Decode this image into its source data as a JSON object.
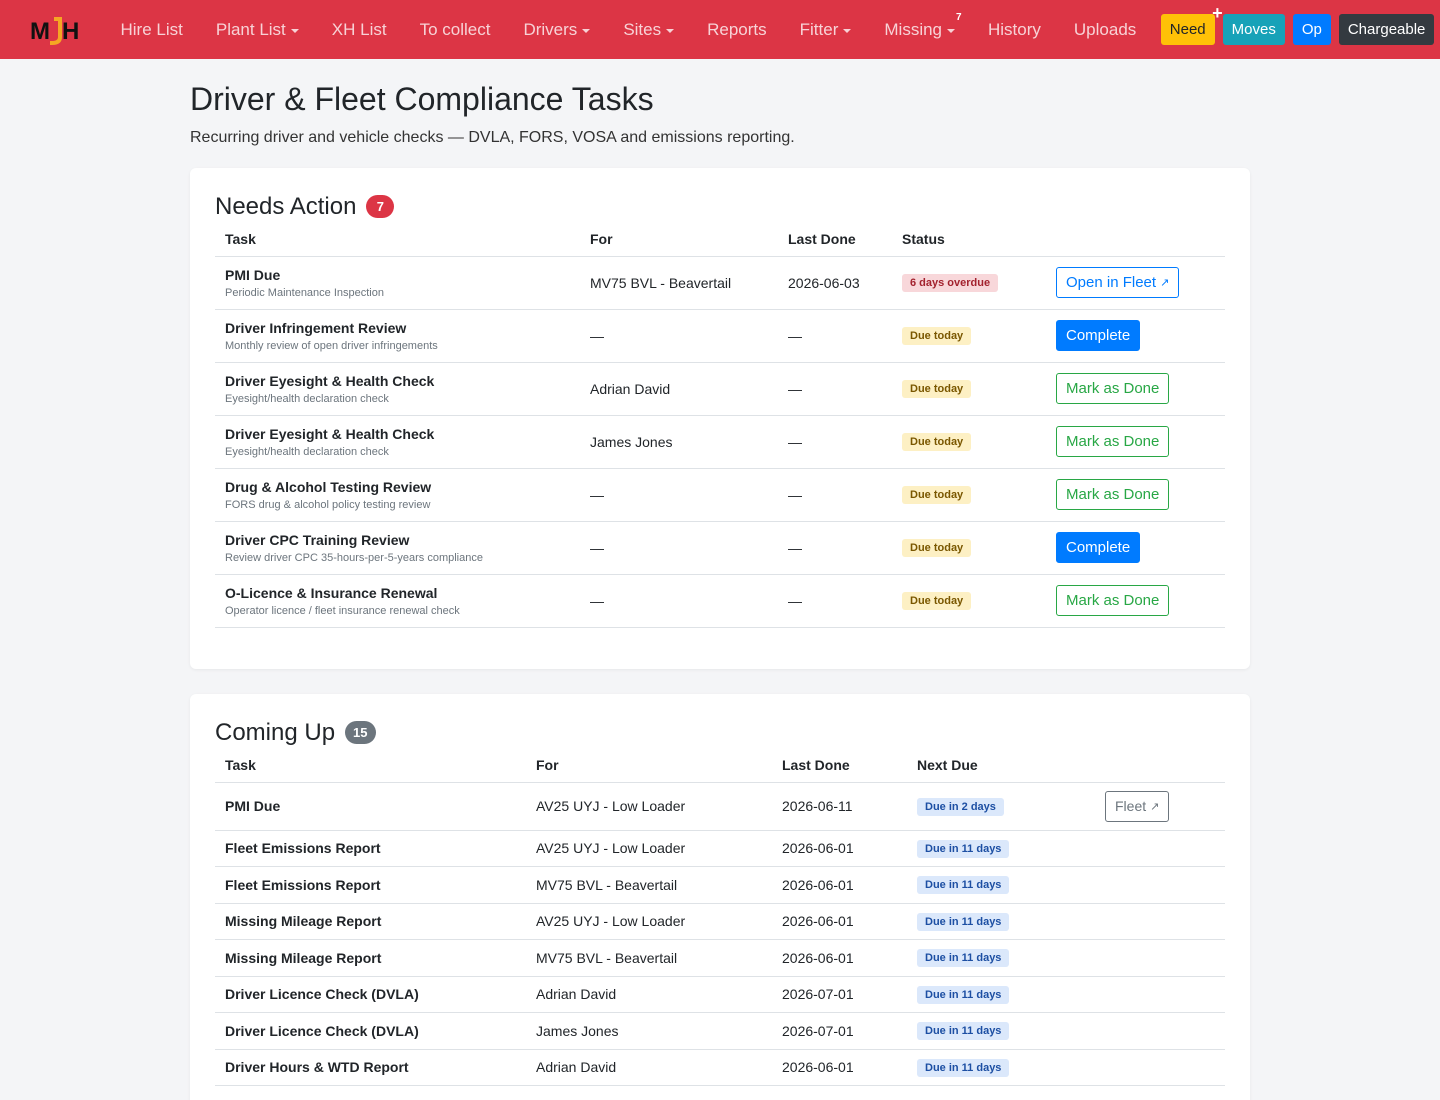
{
  "brand": {
    "logo_text": "MJH",
    "accent": "#dc3545"
  },
  "nav": {
    "items": [
      {
        "label": "Hire List",
        "caret": false
      },
      {
        "label": "Plant List",
        "caret": true
      },
      {
        "label": "XH List",
        "caret": false
      },
      {
        "label": "To collect",
        "caret": false
      },
      {
        "label": "Drivers",
        "caret": true
      },
      {
        "label": "Sites",
        "caret": true
      },
      {
        "label": "Reports",
        "caret": false
      },
      {
        "label": "Fitter",
        "caret": true
      },
      {
        "label": "Missing",
        "caret": true,
        "count": "7"
      },
      {
        "label": "History",
        "caret": false
      },
      {
        "label": "Uploads",
        "caret": false
      }
    ],
    "buttons": {
      "need": "Need",
      "need_plus": "+",
      "moves": "Moves",
      "op": "Op",
      "chargeable": "Chargeable"
    },
    "history_icon": "history-icon"
  },
  "page": {
    "title": "Driver & Fleet Compliance Tasks",
    "subtitle": "Recurring driver and vehicle checks — DVLA, FORS, VOSA and emissions reporting."
  },
  "needs_action": {
    "title": "Needs Action",
    "count": "7",
    "columns": [
      "Task",
      "For",
      "Last Done",
      "Status"
    ],
    "rows": [
      {
        "task": "PMI Due",
        "desc": "Periodic Maintenance Inspection",
        "for": "MV75 BVL - Beavertail",
        "last": "2026-06-03",
        "status": "6 days overdue",
        "status_type": "overdue",
        "action": "Open in Fleet",
        "action_type": "outline-primary",
        "external": true
      },
      {
        "task": "Driver Infringement Review",
        "desc": "Monthly review of open driver infringements",
        "for": "—",
        "last": "—",
        "status": "Due today",
        "status_type": "due",
        "action": "Complete",
        "action_type": "primary",
        "external": false
      },
      {
        "task": "Driver Eyesight & Health Check",
        "desc": "Eyesight/health declaration check",
        "for": "Adrian David",
        "last": "—",
        "status": "Due today",
        "status_type": "due",
        "action": "Mark as Done",
        "action_type": "outline-success",
        "external": false
      },
      {
        "task": "Driver Eyesight & Health Check",
        "desc": "Eyesight/health declaration check",
        "for": "James Jones",
        "last": "—",
        "status": "Due today",
        "status_type": "due",
        "action": "Mark as Done",
        "action_type": "outline-success",
        "external": false
      },
      {
        "task": "Drug & Alcohol Testing Review",
        "desc": "FORS drug & alcohol policy testing review",
        "for": "—",
        "last": "—",
        "status": "Due today",
        "status_type": "due",
        "action": "Mark as Done",
        "action_type": "outline-success",
        "external": false
      },
      {
        "task": "Driver CPC Training Review",
        "desc": "Review driver CPC 35-hours-per-5-years compliance",
        "for": "—",
        "last": "—",
        "status": "Due today",
        "status_type": "due",
        "action": "Complete",
        "action_type": "primary",
        "external": false
      },
      {
        "task": "O-Licence & Insurance Renewal",
        "desc": "Operator licence / fleet insurance renewal check",
        "for": "—",
        "last": "—",
        "status": "Due today",
        "status_type": "due",
        "action": "Mark as Done",
        "action_type": "outline-success",
        "external": false
      }
    ]
  },
  "coming_up": {
    "title": "Coming Up",
    "count": "15",
    "columns": [
      "Task",
      "For",
      "Last Done",
      "Next Due"
    ],
    "rows": [
      {
        "task": "PMI Due",
        "for": "AV25 UYJ - Low Loader",
        "last": "2026-06-11",
        "due": "Due in 2 days",
        "action": "Fleet"
      },
      {
        "task": "Fleet Emissions Report",
        "for": "AV25 UYJ - Low Loader",
        "last": "2026-06-01",
        "due": "Due in 11 days",
        "action": ""
      },
      {
        "task": "Fleet Emissions Report",
        "for": "MV75 BVL - Beavertail",
        "last": "2026-06-01",
        "due": "Due in 11 days",
        "action": ""
      },
      {
        "task": "Missing Mileage Report",
        "for": "AV25 UYJ - Low Loader",
        "last": "2026-06-01",
        "due": "Due in 11 days",
        "action": ""
      },
      {
        "task": "Missing Mileage Report",
        "for": "MV75 BVL - Beavertail",
        "last": "2026-06-01",
        "due": "Due in 11 days",
        "action": ""
      },
      {
        "task": "Driver Licence Check (DVLA)",
        "for": "Adrian David",
        "last": "2026-07-01",
        "due": "Due in 11 days",
        "action": ""
      },
      {
        "task": "Driver Licence Check (DVLA)",
        "for": "James Jones",
        "last": "2026-07-01",
        "due": "Due in 11 days",
        "action": ""
      },
      {
        "task": "Driver Hours & WTD Report",
        "for": "Adrian David",
        "last": "2026-06-01",
        "due": "Due in 11 days",
        "action": ""
      }
    ]
  }
}
